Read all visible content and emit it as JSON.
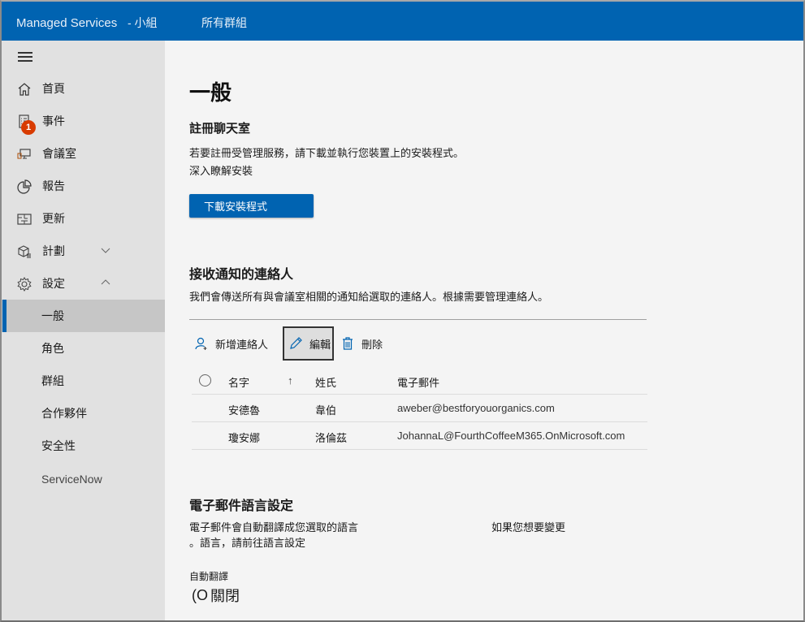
{
  "header": {
    "app_title": "Managed Services",
    "group_label": "- 小組",
    "all_groups_link": "所有群組",
    "brand_color": "#0063b1"
  },
  "sidebar": {
    "menu_icon": "hamburger-icon",
    "items": [
      {
        "label": "首頁",
        "icon": "home-icon"
      },
      {
        "label": "事件",
        "icon": "checklist-icon",
        "badge": "1"
      },
      {
        "label": "會議室",
        "icon": "device-icon"
      },
      {
        "label": "報告",
        "icon": "pie-chart-icon"
      },
      {
        "label": "更新",
        "icon": "update-icon"
      },
      {
        "label": "計劃",
        "icon": "package-icon",
        "expander": "chevron-down-icon"
      },
      {
        "label": "設定",
        "icon": "gear-icon",
        "expander": "chevron-up-icon"
      }
    ],
    "sub_items": [
      {
        "label": "一般",
        "active": true
      },
      {
        "label": "角色"
      },
      {
        "label": "群組"
      },
      {
        "label": "合作夥伴"
      },
      {
        "label": "安全性"
      },
      {
        "label": "ServiceNow"
      }
    ]
  },
  "main": {
    "title": "一般",
    "enroll": {
      "heading": "註冊聊天室",
      "description": "若要註冊受管理服務，請下載並執行您裝置上的安裝程式。",
      "learn_more": "深入瞭解安裝",
      "download_button": "下載安裝程式"
    },
    "contacts": {
      "heading": "接收通知的連絡人",
      "description": "我們會傳送所有與會議室相關的通知給選取的連絡人。根據需要管理連絡人。",
      "commands": {
        "add": "新增連絡人",
        "edit": "編輯",
        "delete": "刪除"
      },
      "columns": {
        "first_name": "名字",
        "sort_indicator": "↑",
        "last_name": "姓氏",
        "email": "電子郵件"
      },
      "rows": [
        {
          "first_name": "安德魯",
          "last_name": "韋伯",
          "email": "aweber@bestforyouorganics.com"
        },
        {
          "first_name": "瓊安娜",
          "last_name": "洛倫茲",
          "email": "JohannaL@FourthCoffeeM365.OnMicrosoft.com"
        }
      ]
    },
    "language": {
      "heading": "電子郵件語言設定",
      "description_part1": "電子郵件會自動翻譯成您選取的語言",
      "description_part2": "如果您想要變更",
      "description_part3": "。語言，請前往語言設定",
      "auto_translate_label": "自動翻譯",
      "toggle_prefix": "(O",
      "toggle_state": "關閉"
    }
  }
}
